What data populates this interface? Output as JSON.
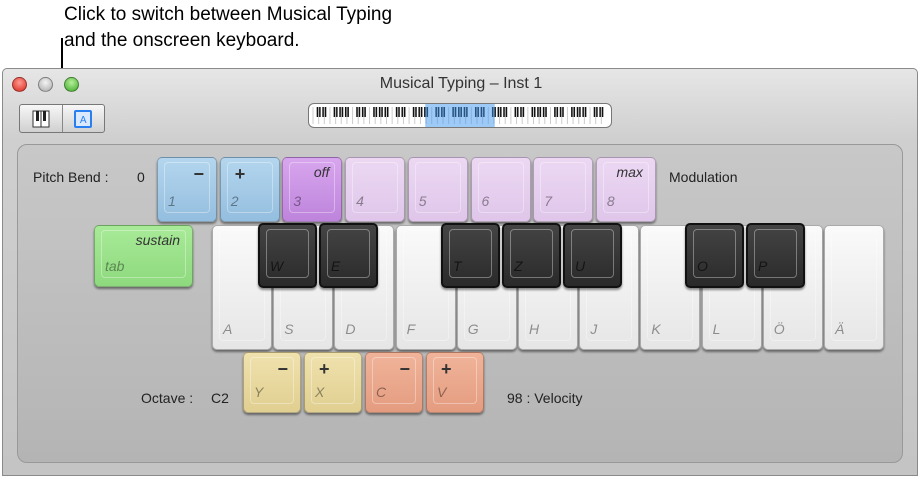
{
  "callout": {
    "line1": "Click to switch between Musical Typing",
    "line2": "and the onscreen keyboard."
  },
  "window": {
    "title": "Musical Typing – Inst 1"
  },
  "toggle": {
    "piano_icon": "piano-icon",
    "typing_icon": "musical-typing-icon",
    "typing_letter": "A"
  },
  "mini_keyboard": {
    "visible_range_start": 0.385,
    "visible_range_end": 0.615
  },
  "pitch_bend": {
    "label": "Pitch Bend :",
    "value": "0",
    "modulation_label": "Modulation",
    "keys": [
      {
        "key": "1",
        "func": "−",
        "cls": "blue"
      },
      {
        "key": "2",
        "func": "+",
        "cls": "blue"
      },
      {
        "key": "3",
        "func": "off",
        "cls": "purple"
      },
      {
        "key": "4",
        "func": "",
        "cls": "lilac"
      },
      {
        "key": "5",
        "func": "",
        "cls": "lilac"
      },
      {
        "key": "6",
        "func": "",
        "cls": "lilac"
      },
      {
        "key": "7",
        "func": "",
        "cls": "lilac"
      },
      {
        "key": "8",
        "func": "max",
        "cls": "lilac"
      }
    ]
  },
  "sustain": {
    "key": "tab",
    "func": "sustain"
  },
  "white_keys": [
    "A",
    "S",
    "D",
    "F",
    "G",
    "H",
    "J",
    "K",
    "L",
    "Ö",
    "Ä"
  ],
  "black_keys": [
    "W",
    "E",
    "T",
    "Z",
    "U",
    "O",
    "P"
  ],
  "octave": {
    "label": "Octave :",
    "value": "C2",
    "keys": [
      {
        "key": "Y",
        "func": "−"
      },
      {
        "key": "X",
        "func": "+"
      }
    ]
  },
  "velocity": {
    "label": "98 : Velocity",
    "keys": [
      {
        "key": "C",
        "func": "−"
      },
      {
        "key": "V",
        "func": "+"
      }
    ]
  },
  "colors": {
    "pitch": "#a6cbe7",
    "mod_on": "#cc96e5",
    "mod": "#e6cff0",
    "sustain": "#9be28b",
    "octave": "#e8d9a0",
    "velocity": "#eaa88d"
  }
}
